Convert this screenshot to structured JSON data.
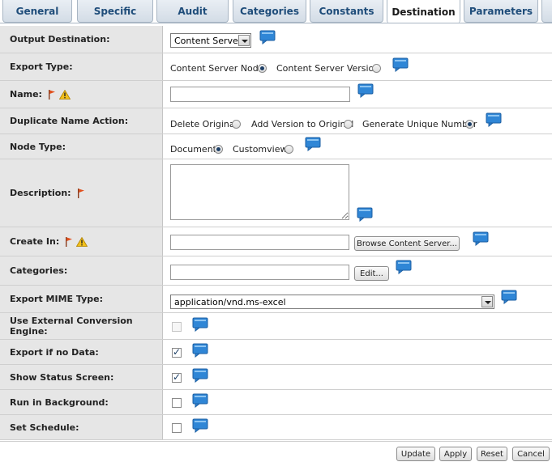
{
  "tabs": [
    {
      "label": "General",
      "active": false
    },
    {
      "label": "Specific",
      "active": false
    },
    {
      "label": "Audit",
      "active": false
    },
    {
      "label": "Categories",
      "active": false
    },
    {
      "label": "Constants",
      "active": false
    },
    {
      "label": "Destination",
      "active": true
    },
    {
      "label": "Parameters",
      "active": false
    }
  ],
  "rows": {
    "output_destination": {
      "label": "Output Destination:",
      "select_value": "Content Server"
    },
    "export_type": {
      "label": "Export Type:",
      "option1": "Content Server Node",
      "option2": "Content Server Version",
      "selected": "option1"
    },
    "name": {
      "label": "Name:",
      "value": ""
    },
    "duplicate_name_action": {
      "label": "Duplicate Name Action:",
      "option1": "Delete Original",
      "option2": "Add Version to Original",
      "option3": "Generate Unique Number",
      "selected": "option3"
    },
    "node_type": {
      "label": "Node Type:",
      "option1": "Document",
      "option2": "Customview",
      "selected": "option1"
    },
    "description": {
      "label": "Description:",
      "value": ""
    },
    "create_in": {
      "label": "Create In:",
      "value": "",
      "button": "Browse Content Server..."
    },
    "categories": {
      "label": "Categories:",
      "value": "",
      "button": "Edit..."
    },
    "export_mime_type": {
      "label": "Export MIME Type:",
      "select_value": "application/vnd.ms-excel"
    },
    "use_external_conversion": {
      "label": "Use External Conversion Engine:",
      "checked": false,
      "disabled": true
    },
    "export_if_no_data": {
      "label": "Export if no Data:",
      "checked": true
    },
    "show_status_screen": {
      "label": "Show Status Screen:",
      "checked": true
    },
    "run_in_background": {
      "label": "Run in Background:",
      "checked": false
    },
    "set_schedule": {
      "label": "Set Schedule:",
      "checked": false
    }
  },
  "footer": {
    "update": "Update",
    "apply": "Apply",
    "reset": "Reset",
    "cancel": "Cancel"
  },
  "colors": {
    "tab_text": "#1f4d7a",
    "label_bg": "#e6e6e6",
    "bubble_blue": "#2f86d6",
    "flag_red": "#d9441a",
    "warning_yellow": "#f2c01a"
  }
}
